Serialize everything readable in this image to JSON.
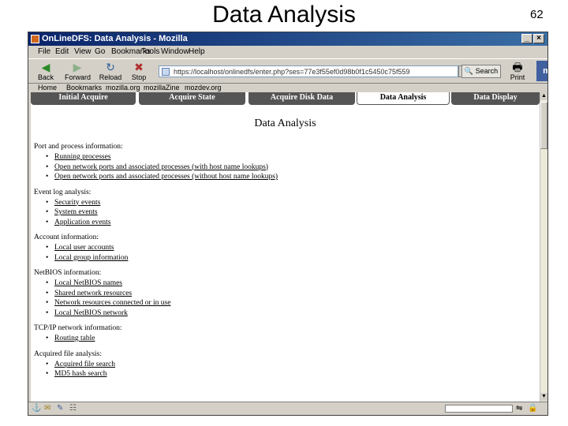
{
  "slide": {
    "title": "Data Analysis",
    "page_number": "62"
  },
  "window": {
    "title": "OnLineDFS: Data Analysis - Mozilla"
  },
  "menu": [
    "File",
    "Edit",
    "View",
    "Go",
    "Bookmarks",
    "Tools",
    "Window",
    "Help"
  ],
  "nav": {
    "back": "Back",
    "forward": "Forward",
    "reload": "Reload",
    "stop": "Stop",
    "url": "https://localhost/onlinedfs/enter.php?ses=77e3f55ef0d98b0f1c5450c75f559",
    "search": "Search",
    "print": "Print"
  },
  "bookmarks": [
    "Home",
    "Bookmarks",
    "mozilla.org",
    "mozillaZine",
    "mozdev.org"
  ],
  "tabs": [
    {
      "label": "Initial Acquire",
      "active": false
    },
    {
      "label": "Acquire State",
      "active": false
    },
    {
      "label": "Acquire Disk Data",
      "active": false
    },
    {
      "label": "Data Analysis",
      "active": true
    },
    {
      "label": "Data Display",
      "active": false
    }
  ],
  "page": {
    "heading": "Data Analysis",
    "sections": [
      {
        "title": "Port and process information:",
        "links": [
          "Running processes",
          "Open network ports and associated processes (with host name lookups)",
          "Open network ports and associated processes (without host name lookups)"
        ]
      },
      {
        "title": "Event log analysis:",
        "links": [
          "Security events",
          "System events",
          "Application events"
        ]
      },
      {
        "title": "Account information:",
        "links": [
          "Local user accounts",
          "Local group information"
        ]
      },
      {
        "title": "NetBIOS information:",
        "links": [
          "Local NetBIOS names",
          "Shared network resources",
          "Network resources connected or in use",
          "Local NetBIOS network"
        ]
      },
      {
        "title": "TCP/IP network information:",
        "links": [
          "Routing table"
        ]
      },
      {
        "title": "Acquired file analysis:",
        "links": [
          "Acquired file search",
          "MD5 hash search"
        ]
      }
    ]
  }
}
